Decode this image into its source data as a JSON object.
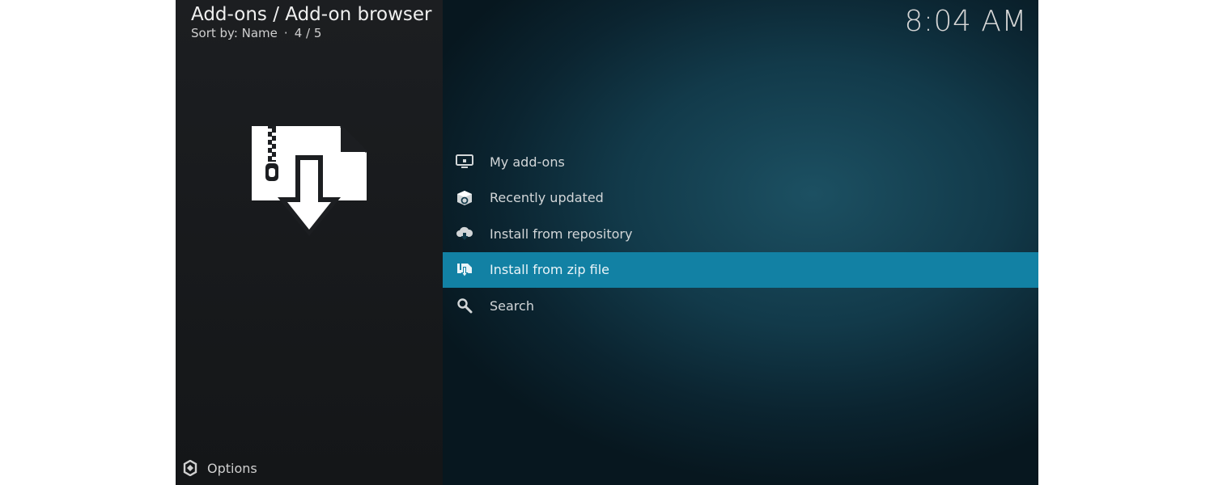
{
  "header": {
    "title": "Add-ons / Add-on browser",
    "sort_label": "Sort by: Name",
    "separator": "·",
    "position": "4 / 5"
  },
  "clock": "8:04 AM",
  "preview": {
    "icon": "zip-download-icon"
  },
  "menu": {
    "selected_index": 3,
    "items": [
      {
        "label": "My add-ons",
        "icon": "monitor-icon"
      },
      {
        "label": "Recently updated",
        "icon": "box-refresh-icon"
      },
      {
        "label": "Install from repository",
        "icon": "cloud-download-icon"
      },
      {
        "label": "Install from zip file",
        "icon": "zip-file-icon"
      },
      {
        "label": "Search",
        "icon": "search-icon"
      }
    ]
  },
  "footer": {
    "options_label": "Options",
    "icon": "options-icon"
  },
  "colors": {
    "highlight": "#1281a4",
    "left_panel": "#1c1e21",
    "right_panel": "#123a4a"
  }
}
